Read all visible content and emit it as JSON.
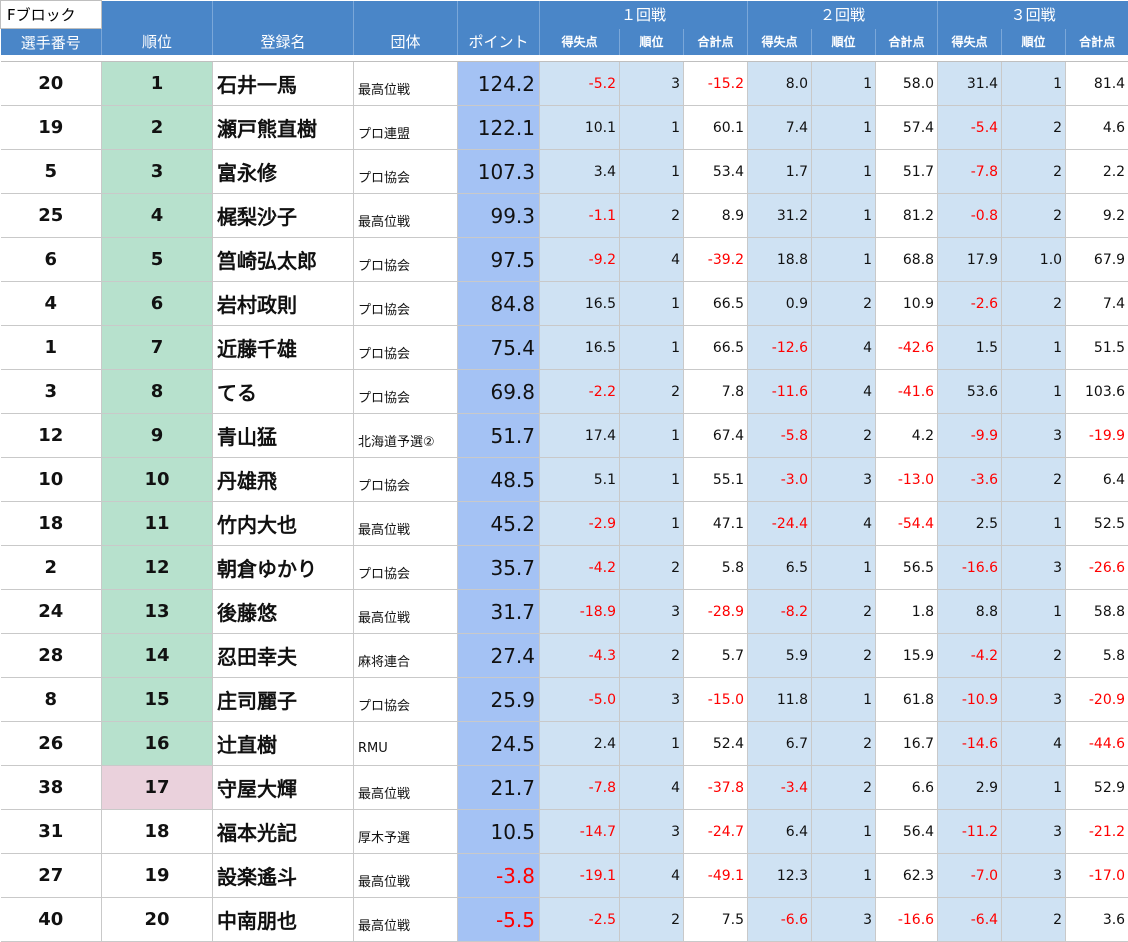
{
  "block_label": "Fブロック",
  "headers": {
    "player_no": "選手番号",
    "rank": "順位",
    "name": "登録名",
    "team": "団体",
    "points": "ポイント",
    "rounds": [
      "１回戦",
      "２回戦",
      "３回戦"
    ],
    "sub": [
      "得失点",
      "順位",
      "合計点"
    ]
  },
  "rows": [
    {
      "no": "20",
      "rank": "1",
      "name": "石井一馬",
      "team": "最高位戦",
      "points": "124.2",
      "r1": [
        "-5.2",
        "3",
        "-15.2"
      ],
      "r2": [
        "8.0",
        "1",
        "58.0"
      ],
      "r3": [
        "31.4",
        "1",
        "81.4"
      ]
    },
    {
      "no": "19",
      "rank": "2",
      "name": "瀬戸熊直樹",
      "team": "プロ連盟",
      "points": "122.1",
      "r1": [
        "10.1",
        "1",
        "60.1"
      ],
      "r2": [
        "7.4",
        "1",
        "57.4"
      ],
      "r3": [
        "-5.4",
        "2",
        "4.6"
      ]
    },
    {
      "no": "5",
      "rank": "3",
      "name": "富永修",
      "team": "プロ協会",
      "points": "107.3",
      "r1": [
        "3.4",
        "1",
        "53.4"
      ],
      "r2": [
        "1.7",
        "1",
        "51.7"
      ],
      "r3": [
        "-7.8",
        "2",
        "2.2"
      ]
    },
    {
      "no": "25",
      "rank": "4",
      "name": "梶梨沙子",
      "team": "最高位戦",
      "points": "99.3",
      "r1": [
        "-1.1",
        "2",
        "8.9"
      ],
      "r2": [
        "31.2",
        "1",
        "81.2"
      ],
      "r3": [
        "-0.8",
        "2",
        "9.2"
      ]
    },
    {
      "no": "6",
      "rank": "5",
      "name": "筥崎弘太郎",
      "team": "プロ協会",
      "points": "97.5",
      "r1": [
        "-9.2",
        "4",
        "-39.2"
      ],
      "r2": [
        "18.8",
        "1",
        "68.8"
      ],
      "r3": [
        "17.9",
        "1.0",
        "67.9"
      ]
    },
    {
      "no": "4",
      "rank": "6",
      "name": "岩村政則",
      "team": "プロ協会",
      "points": "84.8",
      "r1": [
        "16.5",
        "1",
        "66.5"
      ],
      "r2": [
        "0.9",
        "2",
        "10.9"
      ],
      "r3": [
        "-2.6",
        "2",
        "7.4"
      ]
    },
    {
      "no": "1",
      "rank": "7",
      "name": "近藤千雄",
      "team": "プロ協会",
      "points": "75.4",
      "r1": [
        "16.5",
        "1",
        "66.5"
      ],
      "r2": [
        "-12.6",
        "4",
        "-42.6"
      ],
      "r3": [
        "1.5",
        "1",
        "51.5"
      ]
    },
    {
      "no": "3",
      "rank": "8",
      "name": "てる",
      "team": "プロ協会",
      "points": "69.8",
      "r1": [
        "-2.2",
        "2",
        "7.8"
      ],
      "r2": [
        "-11.6",
        "4",
        "-41.6"
      ],
      "r3": [
        "53.6",
        "1",
        "103.6"
      ]
    },
    {
      "no": "12",
      "rank": "9",
      "name": "青山猛",
      "team": "北海道予選②",
      "points": "51.7",
      "r1": [
        "17.4",
        "1",
        "67.4"
      ],
      "r2": [
        "-5.8",
        "2",
        "4.2"
      ],
      "r3": [
        "-9.9",
        "3",
        "-19.9"
      ]
    },
    {
      "no": "10",
      "rank": "10",
      "name": "丹雄飛",
      "team": "プロ協会",
      "points": "48.5",
      "r1": [
        "5.1",
        "1",
        "55.1"
      ],
      "r2": [
        "-3.0",
        "3",
        "-13.0"
      ],
      "r3": [
        "-3.6",
        "2",
        "6.4"
      ]
    },
    {
      "no": "18",
      "rank": "11",
      "name": "竹内大也",
      "team": "最高位戦",
      "points": "45.2",
      "r1": [
        "-2.9",
        "1",
        "47.1"
      ],
      "r2": [
        "-24.4",
        "4",
        "-54.4"
      ],
      "r3": [
        "2.5",
        "1",
        "52.5"
      ]
    },
    {
      "no": "2",
      "rank": "12",
      "name": "朝倉ゆかり",
      "team": "プロ協会",
      "points": "35.7",
      "r1": [
        "-4.2",
        "2",
        "5.8"
      ],
      "r2": [
        "6.5",
        "1",
        "56.5"
      ],
      "r3": [
        "-16.6",
        "3",
        "-26.6"
      ]
    },
    {
      "no": "24",
      "rank": "13",
      "name": "後藤悠",
      "team": "最高位戦",
      "points": "31.7",
      "r1": [
        "-18.9",
        "3",
        "-28.9"
      ],
      "r2": [
        "-8.2",
        "2",
        "1.8"
      ],
      "r3": [
        "8.8",
        "1",
        "58.8"
      ]
    },
    {
      "no": "28",
      "rank": "14",
      "name": "忍田幸夫",
      "team": "麻将連合",
      "points": "27.4",
      "r1": [
        "-4.3",
        "2",
        "5.7"
      ],
      "r2": [
        "5.9",
        "2",
        "15.9"
      ],
      "r3": [
        "-4.2",
        "2",
        "5.8"
      ]
    },
    {
      "no": "8",
      "rank": "15",
      "name": "庄司麗子",
      "team": "プロ協会",
      "points": "25.9",
      "r1": [
        "-5.0",
        "3",
        "-15.0"
      ],
      "r2": [
        "11.8",
        "1",
        "61.8"
      ],
      "r3": [
        "-10.9",
        "3",
        "-20.9"
      ]
    },
    {
      "no": "26",
      "rank": "16",
      "name": "辻直樹",
      "team": "RMU",
      "points": "24.5",
      "r1": [
        "2.4",
        "1",
        "52.4"
      ],
      "r2": [
        "6.7",
        "2",
        "16.7"
      ],
      "r3": [
        "-14.6",
        "4",
        "-44.6"
      ]
    },
    {
      "no": "38",
      "rank": "17",
      "name": "守屋大輝",
      "team": "最高位戦",
      "points": "21.7",
      "r1": [
        "-7.8",
        "4",
        "-37.8"
      ],
      "r2": [
        "-3.4",
        "2",
        "6.6"
      ],
      "r3": [
        "2.9",
        "1",
        "52.9"
      ]
    },
    {
      "no": "31",
      "rank": "18",
      "name": "福本光記",
      "team": "厚木予選",
      "points": "10.5",
      "r1": [
        "-14.7",
        "3",
        "-24.7"
      ],
      "r2": [
        "6.4",
        "1",
        "56.4"
      ],
      "r3": [
        "-11.2",
        "3",
        "-21.2"
      ]
    },
    {
      "no": "27",
      "rank": "19",
      "name": "設楽遙斗",
      "team": "最高位戦",
      "points": "-3.8",
      "r1": [
        "-19.1",
        "4",
        "-49.1"
      ],
      "r2": [
        "12.3",
        "1",
        "62.3"
      ],
      "r3": [
        "-7.0",
        "3",
        "-17.0"
      ]
    },
    {
      "no": "40",
      "rank": "20",
      "name": "中南朋也",
      "team": "最高位戦",
      "points": "-5.5",
      "r1": [
        "-2.5",
        "2",
        "7.5"
      ],
      "r2": [
        "-6.6",
        "3",
        "-16.6"
      ],
      "r3": [
        "-6.4",
        "2",
        "3.6"
      ]
    }
  ],
  "colors": {
    "header_bg": "#4a86c8",
    "points_bg": "#a4c2f4",
    "round_bg": "#cfe2f3",
    "rank_qualified": "#b7e1cd",
    "rank_playoff": "#ead1dc",
    "negative_text": "#ff0000"
  }
}
